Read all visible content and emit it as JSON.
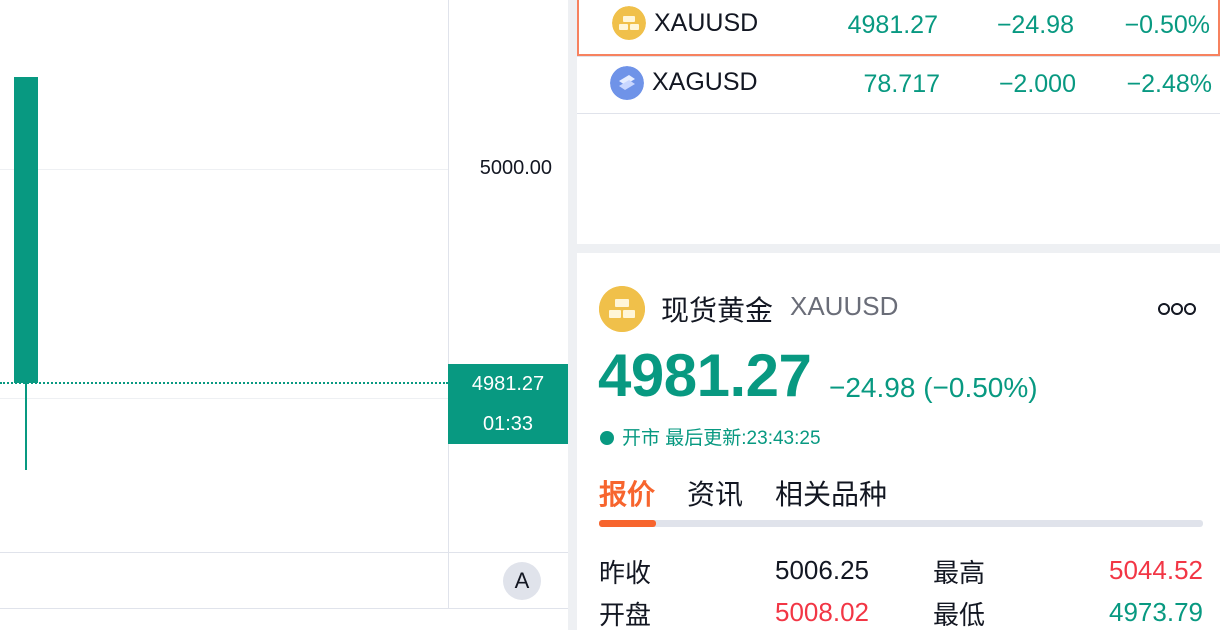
{
  "colors": {
    "accent_green": "#089981",
    "accent_red": "#f23645",
    "tab_active": "#f7652e",
    "selected_row_border": "#f7825f",
    "gold_icon": "#f0c04a",
    "silver_icon": "#6f93e8"
  },
  "chart": {
    "axis_labels": [
      "5000.00"
    ],
    "last_price": "4981.27",
    "countdown": "01:33",
    "auto_scale_label": "A",
    "candle": {
      "open": 5008.02,
      "close": 4981.27,
      "high": 5004.0,
      "low": 4968.5
    }
  },
  "watchlist": [
    {
      "icon": "gold-bar-icon",
      "symbol": "XAUUSD",
      "last": "4981.27",
      "change": "−24.98",
      "change_pct": "−0.50%",
      "selected": true
    },
    {
      "icon": "silver-bar-icon",
      "symbol": "XAGUSD",
      "last": "78.717",
      "change": "−2.000",
      "change_pct": "−2.48%",
      "selected": false
    }
  ],
  "details": {
    "icon": "gold-bar-icon",
    "name": "现货黄金",
    "symbol": "XAUUSD",
    "more_icon": "more-dots-icon",
    "price": "4981.27",
    "change_text": "−24.98 (−0.50%)",
    "status_text": "开市 最后更新:23:43:25",
    "tabs": [
      {
        "label": "报价",
        "active": true
      },
      {
        "label": "资讯",
        "active": false
      },
      {
        "label": "相关品种",
        "active": false
      }
    ],
    "quotes": [
      {
        "label": "昨收",
        "value": "5006.25",
        "tone": "neutral"
      },
      {
        "label": "最高",
        "value": "5044.52",
        "tone": "up"
      },
      {
        "label": "开盘",
        "value": "5008.02",
        "tone": "up"
      },
      {
        "label": "最低",
        "value": "4973.79",
        "tone": "down"
      }
    ]
  }
}
